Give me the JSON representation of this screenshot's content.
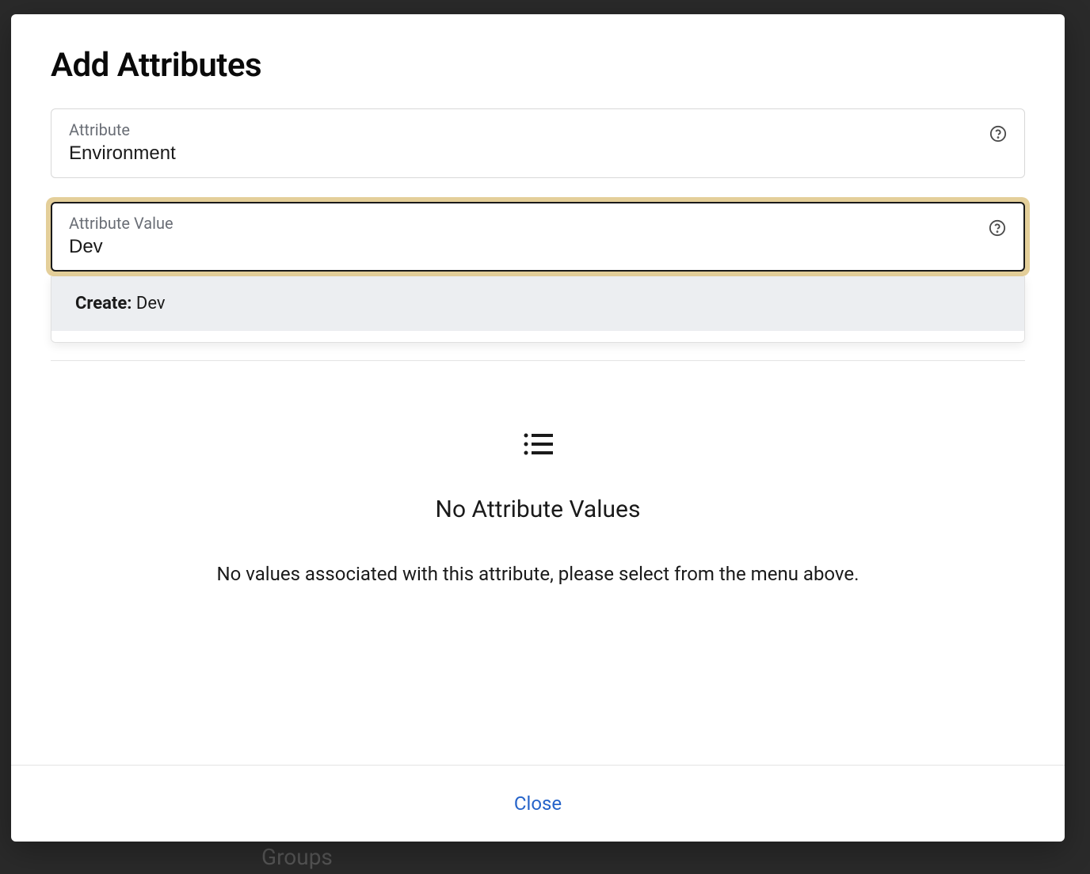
{
  "modal": {
    "title": "Add Attributes",
    "attribute_field": {
      "label": "Attribute",
      "value": "Environment"
    },
    "value_field": {
      "label": "Attribute Value",
      "value": "Dev"
    },
    "dropdown": {
      "create_prefix": "Create:",
      "create_value": "Dev"
    },
    "empty_state": {
      "title": "No Attribute Values",
      "description": "No values associated with this attribute, please select from the menu above."
    },
    "footer": {
      "close_label": "Close"
    }
  },
  "background": {
    "text_groups": "Groups"
  }
}
